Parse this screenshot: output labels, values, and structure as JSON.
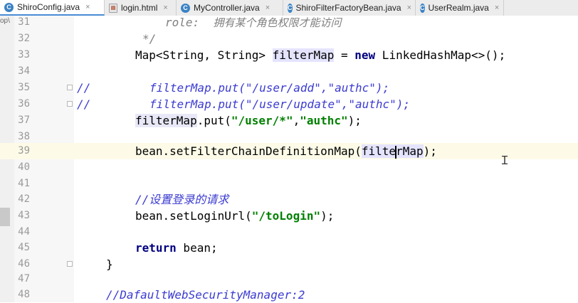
{
  "tabs": [
    {
      "label": "ShiroConfig.java",
      "icon": "C",
      "active": true
    },
    {
      "label": "login.html",
      "icon": "html"
    },
    {
      "label": "MyController.java",
      "icon": "C"
    },
    {
      "label": "ShiroFilterFactoryBean.java",
      "icon": "C"
    },
    {
      "label": "UserRealm.java",
      "icon": "C"
    }
  ],
  "left_stub": "op\\",
  "lines": [
    {
      "num": "31"
    },
    {
      "num": "32"
    },
    {
      "num": "33"
    },
    {
      "num": "34"
    },
    {
      "num": "35"
    },
    {
      "num": "36"
    },
    {
      "num": "37"
    },
    {
      "num": "38"
    },
    {
      "num": "39"
    },
    {
      "num": "40"
    },
    {
      "num": "41"
    },
    {
      "num": "42"
    },
    {
      "num": "43"
    },
    {
      "num": "44"
    },
    {
      "num": "45"
    },
    {
      "num": "46"
    },
    {
      "num": "47"
    },
    {
      "num": "48"
    }
  ],
  "code": {
    "l31_role": "role:",
    "l31_desc": "拥有某个角色权限才能访问",
    "l32": "*/",
    "l33_type": "Map<String, String> ",
    "l33_var": "filterMap",
    "l33_eq": " = ",
    "l33_new": "new",
    "l33_rest": " LinkedHashMap<>();",
    "l35_slash": "//",
    "l35_code": "filterMap.put(\"/user/add\",\"authc\");",
    "l36_slash": "//",
    "l36_code": "filterMap.put(\"/user/update\",\"authc\");",
    "l37_var": "filterMap",
    "l37_call": ".put(",
    "l37_s1": "\"/user/*\"",
    "l37_comma": ",",
    "l37_s2": "\"authc\"",
    "l37_end": ");",
    "l39_call": "bean.setFilterChainDefinitionMap(",
    "l39_arg_a": "filte",
    "l39_arg_b": "rMap",
    "l39_end": ");",
    "l42": "//设置登录的请求",
    "l43_call": "bean.setLoginUrl(",
    "l43_str": "\"/toLogin\"",
    "l43_end": ");",
    "l45_kw": "return",
    "l45_rest": " bean;",
    "l46": "}",
    "l48": "//DafaultWebSecurityManager:2"
  },
  "colors": {
    "keyword": "#000080",
    "string": "#008000",
    "comment": "#808080",
    "commented_code": "#3b3bd1",
    "current_line": "#fdfbe8"
  }
}
